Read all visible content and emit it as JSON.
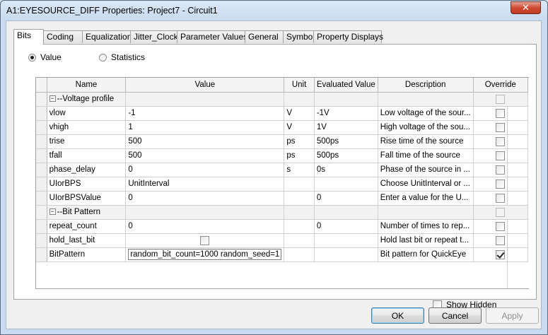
{
  "window": {
    "title": "A1:EYESOURCE_DIFF Properties: Project7 - Circuit1",
    "close_glyph": "✕"
  },
  "tabs": [
    "Bits",
    "Coding",
    "Equalization",
    "Jitter_Clock",
    "Parameter Values",
    "General",
    "Symbol",
    "Property Displays"
  ],
  "active_tab": "Bits",
  "view_mode": {
    "options": [
      "Value",
      "Statistics"
    ],
    "selected": "Value"
  },
  "grid": {
    "columns": [
      "Name",
      "Value",
      "Unit",
      "Evaluated Value",
      "Description",
      "Override"
    ],
    "rows": [
      {
        "type": "group",
        "name": "--Voltage profile",
        "expander": "−"
      },
      {
        "type": "param",
        "name": "vlow",
        "value": "-1",
        "unit": "V",
        "evaluated": "-1V",
        "description": "Low voltage of the sour..."
      },
      {
        "type": "param",
        "name": "vhigh",
        "value": "1",
        "unit": "V",
        "evaluated": "1V",
        "description": "High voltage of the sou..."
      },
      {
        "type": "param",
        "name": "trise",
        "value": "500",
        "unit": "ps",
        "evaluated": "500ps",
        "description": "Rise time of the source"
      },
      {
        "type": "param",
        "name": "tfall",
        "value": "500",
        "unit": "ps",
        "evaluated": "500ps",
        "description": "Fall time of the source"
      },
      {
        "type": "param",
        "name": "phase_delay",
        "value": "0",
        "unit": "s",
        "evaluated": "0s",
        "description": "Phase of the source in ..."
      },
      {
        "type": "param",
        "name": "UIorBPS",
        "value": "UnitInterval",
        "unit": "",
        "evaluated": "",
        "description": "Choose UnitInterval or ..."
      },
      {
        "type": "param",
        "name": "UIorBPSValue",
        "value": "0",
        "unit": "",
        "evaluated": "0",
        "description": "Enter a value for the U..."
      },
      {
        "type": "group",
        "name": "--Bit Pattern",
        "expander": "−"
      },
      {
        "type": "param",
        "name": "repeat_count",
        "value": "0",
        "unit": "",
        "evaluated": "0",
        "description": "Number of times to rep..."
      },
      {
        "type": "checkbox",
        "name": "hold_last_bit",
        "value": "",
        "unit": "",
        "evaluated": "",
        "description": "Hold last bit or repeat t..."
      },
      {
        "type": "edit",
        "name": "BitPattern",
        "value": "random_bit_count=1000 random_seed=1",
        "unit": "",
        "evaluated": "",
        "description": "Bit pattern for QuickEye",
        "override_checked": true
      }
    ]
  },
  "show_hidden": {
    "label": "Show Hidden",
    "checked": false
  },
  "buttons": {
    "ok": "OK",
    "cancel": "Cancel",
    "apply": "Apply"
  }
}
